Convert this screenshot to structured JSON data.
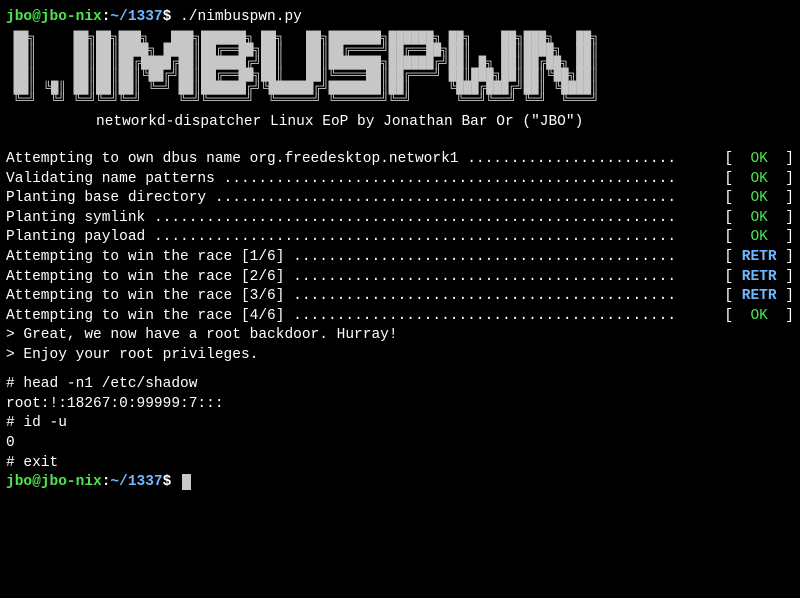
{
  "prompt": {
    "user_host": "jbo@jbo-nix",
    "colon": ":",
    "path": "~/1337",
    "dollar": "$",
    "command": "./nimbuspwn.py"
  },
  "banner_ascii": " ██╗     ██╗██╗███╗   ███╗██████╗ ██╗   ██╗███████╗██████╗ ██╗    ██╗███╗   ██╗\n ██║     ██║██║████╗ ████║██╔══██╗██║   ██║██╔════╝██╔══██╗██║    ██║████╗  ██║\n ██║     ██║██║██╔████╔██║██████╔╝██║   ██║███████╗██████╔╝██║ █╗ ██║██╔██╗ ██║\n ██║     ██║██║██║╚██╔╝██║██╔══██╗██║   ██║╚════██║██╔═══╝ ██║███╗██║██║╚██╗██║\n ██║ ╚█║ ██║██║██║ ╚═╝ ██║██████╔╝╚██████╔╝███████║██║     ╚███╔███╔╝██║ ╚████║\n ╚═╝  ╚╝ ╚═╝╚═╝╚═╝     ╚═╝╚═════╝  ╚═════╝ ╚══════╝╚═╝      ╚══╝╚══╝ ╚═╝  ╚═══╝",
  "subtitle": "networkd-dispatcher Linux EoP by Jonathan Bar Or (\"JBO\")",
  "log": [
    {
      "label": "Attempting to own dbus name org.freedesktop.network1 ",
      "status": "OK",
      "class": "ok"
    },
    {
      "label": "Validating name patterns ",
      "status": "OK",
      "class": "ok"
    },
    {
      "label": "Planting base directory ",
      "status": "OK",
      "class": "ok"
    },
    {
      "label": "Planting symlink ",
      "status": "OK",
      "class": "ok"
    },
    {
      "label": "Planting payload ",
      "status": "OK",
      "class": "ok"
    },
    {
      "label": "Attempting to win the race [1/6] ",
      "status": "RETR",
      "class": "retr"
    },
    {
      "label": "Attempting to win the race [2/6] ",
      "status": "RETR",
      "class": "retr"
    },
    {
      "label": "Attempting to win the race [3/6] ",
      "status": "RETR",
      "class": "retr"
    },
    {
      "label": "Attempting to win the race [4/6] ",
      "status": "OK",
      "class": "ok"
    }
  ],
  "messages": [
    "> Great, we now have a root backdoor. Hurray!",
    "> Enjoy your root privileges."
  ],
  "root_session": [
    "# head -n1 /etc/shadow",
    "root:!:18267:0:99999:7:::",
    "# id -u",
    "0",
    "# exit"
  ],
  "final_prompt": {
    "user_host": "jbo@jbo-nix",
    "colon": ":",
    "path": "~/1337",
    "dollar": "$"
  },
  "dots": "........................................................................................"
}
